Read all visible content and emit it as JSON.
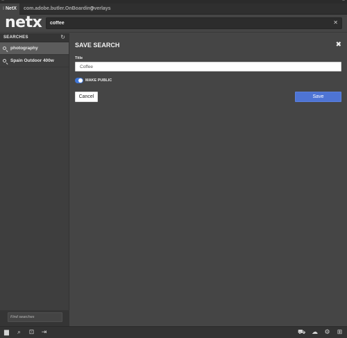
{
  "window": {
    "close_glyph": "×",
    "grip_glyph": "≡"
  },
  "tabs": [
    {
      "label": "NetX",
      "active": true
    },
    {
      "label": "com.adobe.butler.OnBoarding",
      "active": false
    },
    {
      "label": "Overlays",
      "active": false
    }
  ],
  "header": {
    "logo": "netx",
    "search_value": "coffee",
    "clear_glyph": "✕"
  },
  "sidebar": {
    "title": "SEARCHES",
    "refresh_glyph": "↻",
    "items": [
      {
        "label": "photography",
        "selected": true
      },
      {
        "label": "Spain Outdoor 400w",
        "selected": false
      }
    ],
    "find_placeholder": "Find searches"
  },
  "panel": {
    "title": "SAVE SEARCH",
    "close_glyph": "✖",
    "field_label": "Title",
    "field_value": "Coffee",
    "toggle_label": "MAKE PUBLIC",
    "toggle_on": true,
    "cancel_label": "Cancel",
    "save_label": "Save"
  },
  "footer_icons": {
    "folder": "▆",
    "search": "⌕",
    "inbox": "⊡",
    "logout": "⇥",
    "cart": "⛟",
    "cloud": "☁",
    "settings": "⚙",
    "collapse": "⊞"
  },
  "colors": {
    "accent": "#4e74d4",
    "toggle": "#3f76d8",
    "background": "#454545"
  }
}
